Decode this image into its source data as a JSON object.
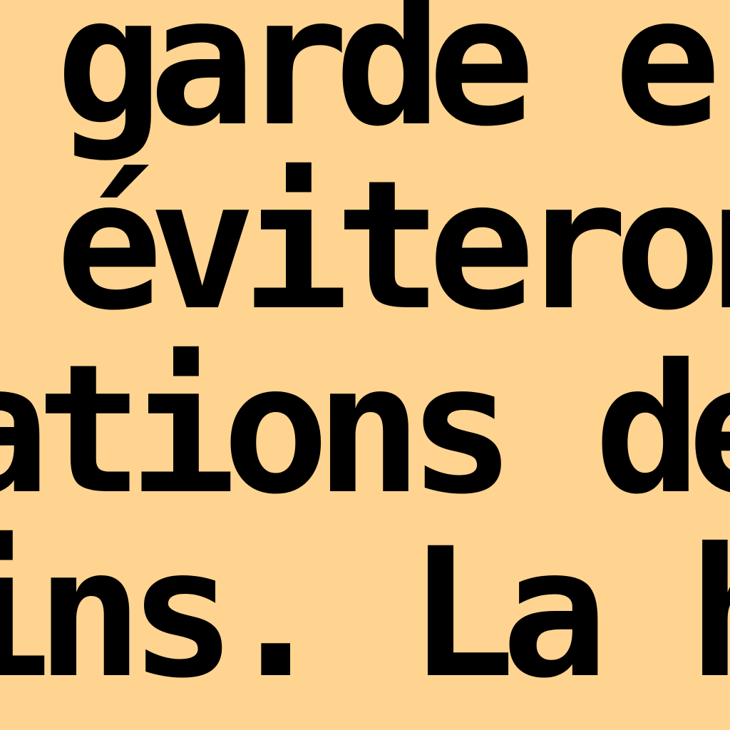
{
  "text_lines": [
    "garde e",
    "éviteron",
    "ations de",
    "ins. La h"
  ],
  "colors": {
    "background": "#ffd490",
    "text": "#000000"
  }
}
